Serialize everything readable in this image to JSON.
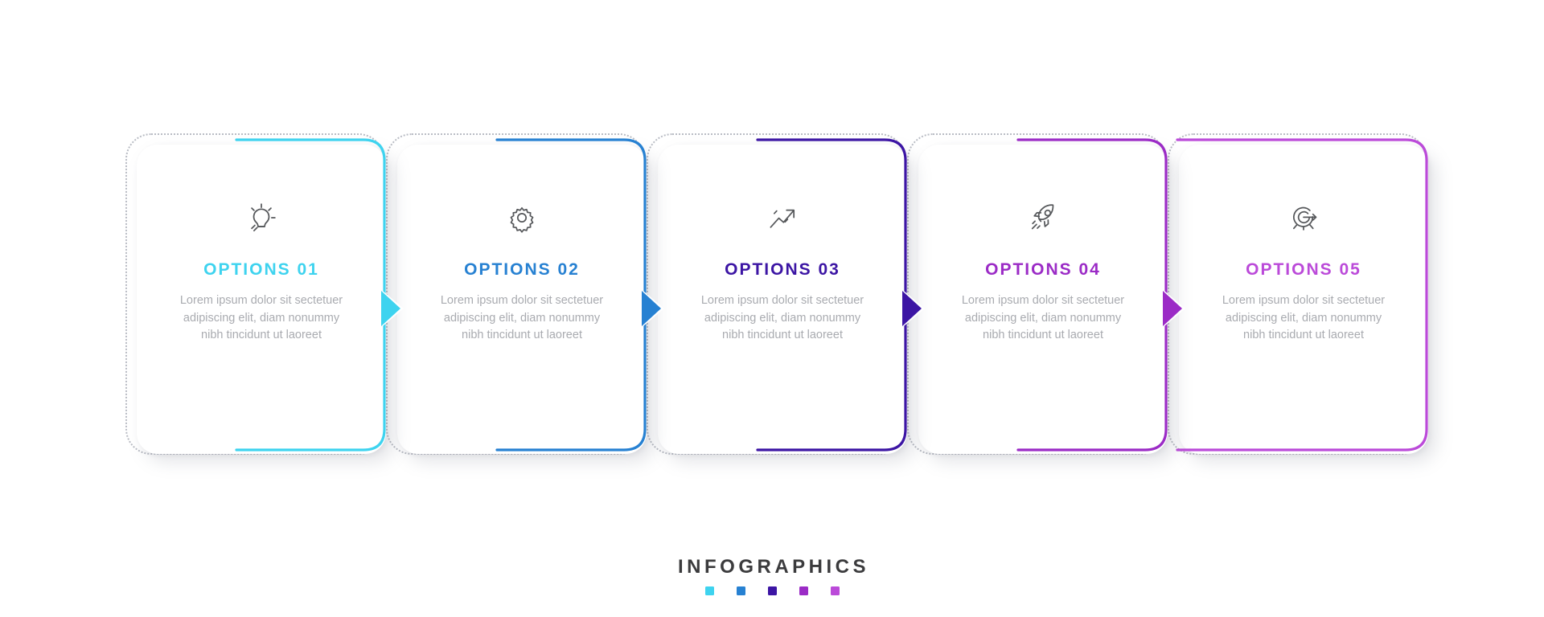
{
  "footer": {
    "title": "INFOGRAPHICS"
  },
  "palette": {
    "step1": "#3ed3ef",
    "step2": "#2781d2",
    "step3": "#3c15a4",
    "step4": "#9b2bc6",
    "step5": "#bb4ad9",
    "icon": "#56585b",
    "body_text": "#a9abb0",
    "dotted_outline": "#b9bcc4",
    "card_background": "#ffffff",
    "page_background": "#ffffff"
  },
  "steps": [
    {
      "title": "OPTIONS 01",
      "description": "Lorem ipsum dolor sit sectetuer adipiscing elit, diam nonummy nibh tincidunt ut laoreet",
      "icon": "lightbulb-icon",
      "color": "#3ed3ef"
    },
    {
      "title": "OPTIONS 02",
      "description": "Lorem ipsum dolor sit sectetuer adipiscing elit, diam nonummy nibh tincidunt ut laoreet",
      "icon": "gear-icon",
      "color": "#2781d2"
    },
    {
      "title": "OPTIONS 03",
      "description": "Lorem ipsum dolor sit sectetuer adipiscing elit, diam nonummy nibh tincidunt ut laoreet",
      "icon": "trending-up-icon",
      "color": "#3c15a4"
    },
    {
      "title": "OPTIONS 04",
      "description": "Lorem ipsum dolor sit sectetuer adipiscing elit, diam nonummy nibh tincidunt ut laoreet",
      "icon": "rocket-icon",
      "color": "#9b2bc6"
    },
    {
      "title": "OPTIONS 05",
      "description": "Lorem ipsum dolor sit sectetuer adipiscing elit, diam nonummy nibh tincidunt ut laoreet",
      "icon": "target-icon",
      "color": "#bb4ad9"
    }
  ],
  "connectors": [
    {
      "after_step": 1,
      "color": "#3ed3ef"
    },
    {
      "after_step": 2,
      "color": "#2781d2"
    },
    {
      "after_step": 3,
      "color": "#3c15a4"
    },
    {
      "after_step": 4,
      "color": "#9b2bc6"
    }
  ],
  "footer_dots": [
    "#3ed3ef",
    "#2781d2",
    "#3c15a4",
    "#9b2bc6",
    "#bb4ad9"
  ]
}
